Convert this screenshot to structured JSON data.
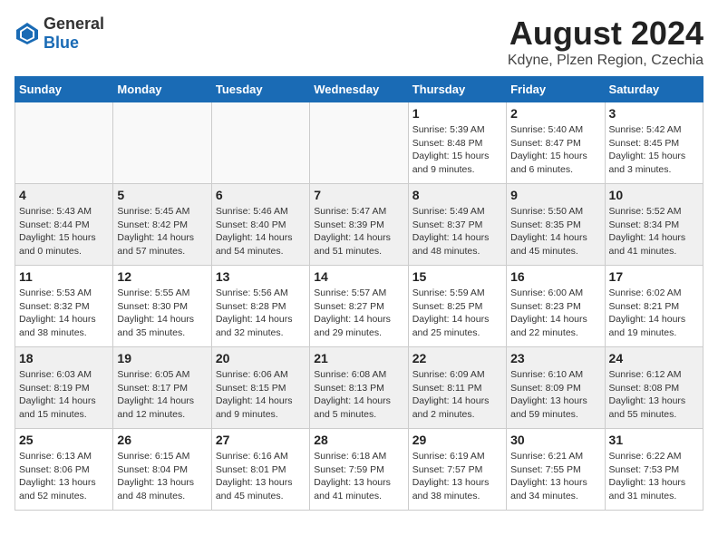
{
  "logo": {
    "general": "General",
    "blue": "Blue"
  },
  "title": "August 2024",
  "subtitle": "Kdyne, Plzen Region, Czechia",
  "days_header": [
    "Sunday",
    "Monday",
    "Tuesday",
    "Wednesday",
    "Thursday",
    "Friday",
    "Saturday"
  ],
  "weeks": [
    [
      {
        "day": "",
        "info": ""
      },
      {
        "day": "",
        "info": ""
      },
      {
        "day": "",
        "info": ""
      },
      {
        "day": "",
        "info": ""
      },
      {
        "day": "1",
        "info": "Sunrise: 5:39 AM\nSunset: 8:48 PM\nDaylight: 15 hours\nand 9 minutes."
      },
      {
        "day": "2",
        "info": "Sunrise: 5:40 AM\nSunset: 8:47 PM\nDaylight: 15 hours\nand 6 minutes."
      },
      {
        "day": "3",
        "info": "Sunrise: 5:42 AM\nSunset: 8:45 PM\nDaylight: 15 hours\nand 3 minutes."
      }
    ],
    [
      {
        "day": "4",
        "info": "Sunrise: 5:43 AM\nSunset: 8:44 PM\nDaylight: 15 hours\nand 0 minutes."
      },
      {
        "day": "5",
        "info": "Sunrise: 5:45 AM\nSunset: 8:42 PM\nDaylight: 14 hours\nand 57 minutes."
      },
      {
        "day": "6",
        "info": "Sunrise: 5:46 AM\nSunset: 8:40 PM\nDaylight: 14 hours\nand 54 minutes."
      },
      {
        "day": "7",
        "info": "Sunrise: 5:47 AM\nSunset: 8:39 PM\nDaylight: 14 hours\nand 51 minutes."
      },
      {
        "day": "8",
        "info": "Sunrise: 5:49 AM\nSunset: 8:37 PM\nDaylight: 14 hours\nand 48 minutes."
      },
      {
        "day": "9",
        "info": "Sunrise: 5:50 AM\nSunset: 8:35 PM\nDaylight: 14 hours\nand 45 minutes."
      },
      {
        "day": "10",
        "info": "Sunrise: 5:52 AM\nSunset: 8:34 PM\nDaylight: 14 hours\nand 41 minutes."
      }
    ],
    [
      {
        "day": "11",
        "info": "Sunrise: 5:53 AM\nSunset: 8:32 PM\nDaylight: 14 hours\nand 38 minutes."
      },
      {
        "day": "12",
        "info": "Sunrise: 5:55 AM\nSunset: 8:30 PM\nDaylight: 14 hours\nand 35 minutes."
      },
      {
        "day": "13",
        "info": "Sunrise: 5:56 AM\nSunset: 8:28 PM\nDaylight: 14 hours\nand 32 minutes."
      },
      {
        "day": "14",
        "info": "Sunrise: 5:57 AM\nSunset: 8:27 PM\nDaylight: 14 hours\nand 29 minutes."
      },
      {
        "day": "15",
        "info": "Sunrise: 5:59 AM\nSunset: 8:25 PM\nDaylight: 14 hours\nand 25 minutes."
      },
      {
        "day": "16",
        "info": "Sunrise: 6:00 AM\nSunset: 8:23 PM\nDaylight: 14 hours\nand 22 minutes."
      },
      {
        "day": "17",
        "info": "Sunrise: 6:02 AM\nSunset: 8:21 PM\nDaylight: 14 hours\nand 19 minutes."
      }
    ],
    [
      {
        "day": "18",
        "info": "Sunrise: 6:03 AM\nSunset: 8:19 PM\nDaylight: 14 hours\nand 15 minutes."
      },
      {
        "day": "19",
        "info": "Sunrise: 6:05 AM\nSunset: 8:17 PM\nDaylight: 14 hours\nand 12 minutes."
      },
      {
        "day": "20",
        "info": "Sunrise: 6:06 AM\nSunset: 8:15 PM\nDaylight: 14 hours\nand 9 minutes."
      },
      {
        "day": "21",
        "info": "Sunrise: 6:08 AM\nSunset: 8:13 PM\nDaylight: 14 hours\nand 5 minutes."
      },
      {
        "day": "22",
        "info": "Sunrise: 6:09 AM\nSunset: 8:11 PM\nDaylight: 14 hours\nand 2 minutes."
      },
      {
        "day": "23",
        "info": "Sunrise: 6:10 AM\nSunset: 8:09 PM\nDaylight: 13 hours\nand 59 minutes."
      },
      {
        "day": "24",
        "info": "Sunrise: 6:12 AM\nSunset: 8:08 PM\nDaylight: 13 hours\nand 55 minutes."
      }
    ],
    [
      {
        "day": "25",
        "info": "Sunrise: 6:13 AM\nSunset: 8:06 PM\nDaylight: 13 hours\nand 52 minutes."
      },
      {
        "day": "26",
        "info": "Sunrise: 6:15 AM\nSunset: 8:04 PM\nDaylight: 13 hours\nand 48 minutes."
      },
      {
        "day": "27",
        "info": "Sunrise: 6:16 AM\nSunset: 8:01 PM\nDaylight: 13 hours\nand 45 minutes."
      },
      {
        "day": "28",
        "info": "Sunrise: 6:18 AM\nSunset: 7:59 PM\nDaylight: 13 hours\nand 41 minutes."
      },
      {
        "day": "29",
        "info": "Sunrise: 6:19 AM\nSunset: 7:57 PM\nDaylight: 13 hours\nand 38 minutes."
      },
      {
        "day": "30",
        "info": "Sunrise: 6:21 AM\nSunset: 7:55 PM\nDaylight: 13 hours\nand 34 minutes."
      },
      {
        "day": "31",
        "info": "Sunrise: 6:22 AM\nSunset: 7:53 PM\nDaylight: 13 hours\nand 31 minutes."
      }
    ]
  ]
}
